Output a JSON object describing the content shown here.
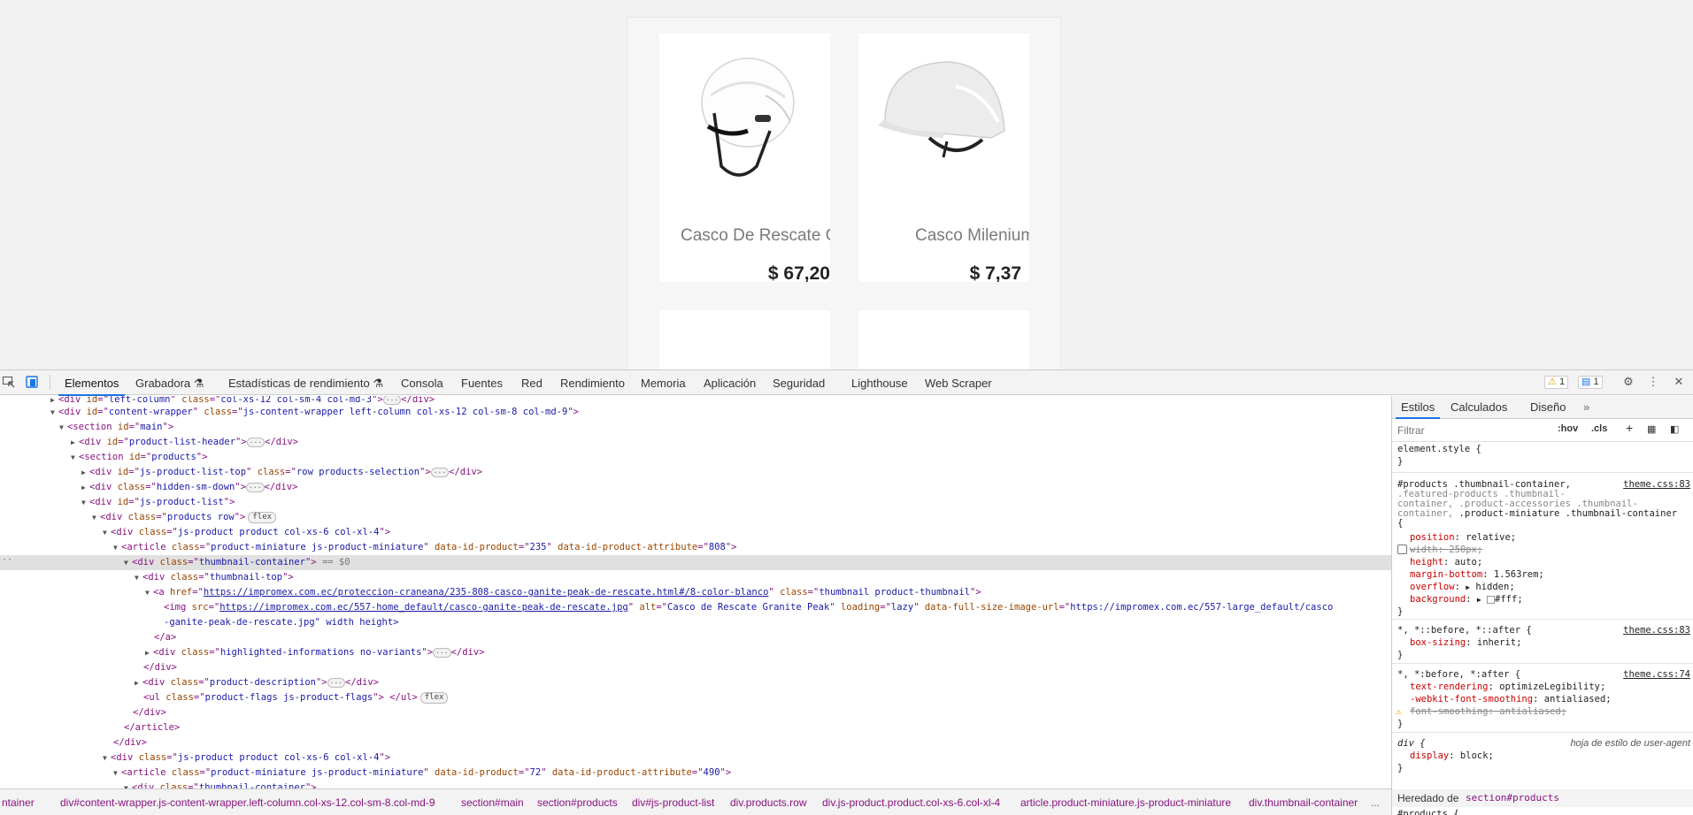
{
  "products": [
    {
      "name": "Casco De Rescate G",
      "price": "$ 67,20",
      "color": "#ffffff"
    },
    {
      "name": "Casco Milenium",
      "price": "$ 7,37",
      "color": "#ffffff"
    },
    {
      "name": "",
      "price": "",
      "color": "#d81818"
    },
    {
      "name": "",
      "price": "",
      "color": "#8fd8b6"
    }
  ],
  "devtools": {
    "tabs": [
      "Elementos",
      "Grabadora",
      "Estadísticas de rendimiento",
      "Consola",
      "Fuentes",
      "Red",
      "Rendimiento",
      "Memoria",
      "Aplicación",
      "Seguridad",
      "Lighthouse",
      "Web Scraper"
    ],
    "warn_count": "1",
    "msg_count": "1",
    "accent": "#1a73e8"
  },
  "dom": {
    "l1_id": "left-column",
    "l1_class": "col-xs-12 col-sm-4 col-md-3",
    "l2_id": "content-wrapper",
    "l2_class": "js-content-wrapper left-column col-xs-12 col-sm-8 col-md-9",
    "l3_id": "main",
    "l4_id": "product-list-header",
    "l5_id": "products",
    "l6_id": "js-product-list-top",
    "l6_class": "row products-selection",
    "l7_class": "hidden-sm-down",
    "l8_id": "js-product-list",
    "l9_class": "products row",
    "flex": "flex",
    "l10_class": "js-product product col-xs-6 col-xl-4",
    "l11_class": "product-miniature js-product-miniature",
    "l11_idp": "235",
    "l11_attr": "808",
    "l12_class": "thumbnail-container",
    "l12_eq": "== $0",
    "l13_class": "thumbnail-top",
    "l14_href": "https://impromex.com.ec/proteccion-craneana/235-808-casco-ganite-peak-de-rescate.html#/8-color-blanco",
    "l14_class": "thumbnail product-thumbnail",
    "l15_src": "https://impromex.com.ec/557-home_default/casco-ganite-peak-de-rescate.jpg",
    "l15_alt": "Casco de Rescate Granite Peak",
    "l15_loading": "lazy",
    "l15_full": "https://impromex.com.ec/557-large_default/casco",
    "l16_cont": "-ganite-peak-de-rescate.jpg\" width height>",
    "l18_class": "highlighted-informations no-variants",
    "l20_class": "product-description",
    "l21_class": "product-flags js-product-flags",
    "l26_idp": "72",
    "l26_attr": "490"
  },
  "breadcrumb": [
    "ntainer",
    "div#content-wrapper.js-content-wrapper.left-column.col-xs-12.col-sm-8.col-md-9",
    "section#main",
    "section#products",
    "div#js-product-list",
    "div.products.row",
    "div.js-product.product.col-xs-6.col-xl-4",
    "article.product-miniature.js-product-miniature",
    "div.thumbnail-container",
    "..."
  ],
  "styles": {
    "tabs": [
      "Estilos",
      "Calculados",
      "Diseño"
    ],
    "filter_placeholder": "Filtrar",
    "hov": ":hov",
    "cls": ".cls",
    "element_style": "element.style {",
    "close": "}",
    "rule1_sel_1": "#products .thumbnail-container,",
    "rule1_sel_2": ".featured-products .thumbnail-",
    "rule1_sel_3": "container, .product-accessories .thumbnail-",
    "rule1_sel_4a": "container, ",
    "rule1_sel_4b": ".product-miniature .thumbnail-container",
    "rule1_src": "theme.css:83",
    "open": "{",
    "p_position": "position",
    "v_position": "relative;",
    "p_width": "width",
    "v_width": "250px;",
    "p_height": "height",
    "v_height": "auto;",
    "p_mb": "margin-bottom",
    "v_mb": "1.563rem;",
    "p_overflow": "overflow",
    "v_overflow": "hidden;",
    "p_bg": "background",
    "v_bg": "#fff;",
    "rule2_sel": "*, *::before, *::after {",
    "rule2_src": "theme.css:83",
    "p_bs": "box-sizing",
    "v_bs": "inherit;",
    "rule3_sel": "*, *:before, *:after {",
    "rule3_src": "theme.css:74",
    "p_tr": "text-rendering",
    "v_tr": "optimizeLegibility;",
    "p_wfs": "-webkit-font-smoothing",
    "v_wfs": "antialiased;",
    "p_fs": "font-smoothing",
    "v_fs": "antialiased;",
    "rule4_sel": "div {",
    "rule4_src": "hoja de estilo de user-agent",
    "p_display": "display",
    "v_display": "block;",
    "inherited_label": "Heredado de",
    "inherited_from": "section#products",
    "last_sel": "#products {"
  }
}
